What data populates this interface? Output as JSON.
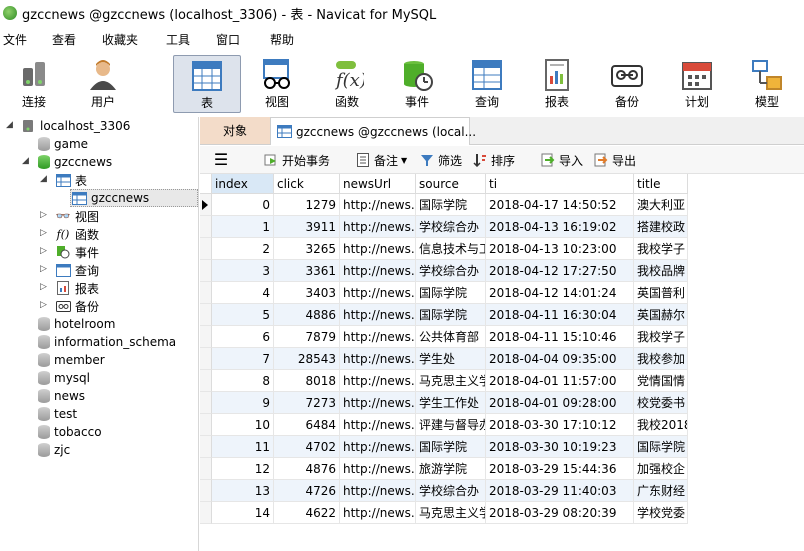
{
  "window": {
    "title": "gzccnews @gzccnews (localhost_3306) - 表 - Navicat for MySQL"
  },
  "menu": [
    "文件",
    "查看",
    "收藏夹",
    "工具",
    "窗口",
    "帮助"
  ],
  "toolbar": [
    {
      "label": "连接",
      "icon": "connection-icon"
    },
    {
      "label": "用户",
      "icon": "user-icon"
    },
    {
      "label": "表",
      "icon": "table-icon"
    },
    {
      "label": "视图",
      "icon": "view-icon"
    },
    {
      "label": "函数",
      "icon": "function-icon"
    },
    {
      "label": "事件",
      "icon": "event-icon"
    },
    {
      "label": "查询",
      "icon": "query-icon"
    },
    {
      "label": "报表",
      "icon": "report-icon"
    },
    {
      "label": "备份",
      "icon": "backup-icon"
    },
    {
      "label": "计划",
      "icon": "schedule-icon"
    },
    {
      "label": "模型",
      "icon": "model-icon"
    }
  ],
  "tree": {
    "connection": "localhost_3306",
    "databases": [
      "game",
      "gzccnews",
      "hotelroom",
      "information_schema",
      "member",
      "mysql",
      "news",
      "test",
      "tobacco",
      "zjc"
    ],
    "gzccnews_children": {
      "tables": "表",
      "table_item": "gzccnews",
      "others": [
        "视图",
        "函数",
        "事件",
        "查询",
        "报表",
        "备份"
      ]
    }
  },
  "tabs": {
    "objects": "对象",
    "table_tab": "gzccnews @gzccnews (local..."
  },
  "table_tools": {
    "begin_tx": "开始事务",
    "note": "备注",
    "filter": "筛选",
    "sort": "排序",
    "import": "导入",
    "export": "导出"
  },
  "grid": {
    "columns": [
      "index",
      "click",
      "newsUrl",
      "source",
      "ti",
      "title"
    ],
    "rows": [
      [
        "0",
        "1279",
        "http://news.g",
        "国际学院",
        "2018-04-17 14:50:52",
        "澳大利亚"
      ],
      [
        "1",
        "3911",
        "http://news.g",
        "学校综合办",
        "2018-04-13 16:19:02",
        "搭建校政"
      ],
      [
        "2",
        "3265",
        "http://news.g",
        "信息技术与工",
        "2018-04-13 10:23:00",
        "我校学子"
      ],
      [
        "3",
        "3361",
        "http://news.g",
        "学校综合办",
        "2018-04-12 17:27:50",
        "我校品牌"
      ],
      [
        "4",
        "3403",
        "http://news.g",
        "国际学院",
        "2018-04-12 14:01:24",
        "英国普利"
      ],
      [
        "5",
        "4886",
        "http://news.g",
        "国际学院",
        "2018-04-11 16:30:04",
        "英国赫尔"
      ],
      [
        "6",
        "7879",
        "http://news.g",
        "公共体育部",
        "2018-04-11 15:10:46",
        "我校学子"
      ],
      [
        "7",
        "28543",
        "http://news.g",
        "学生处",
        "2018-04-04 09:35:00",
        "我校参加"
      ],
      [
        "8",
        "8018",
        "http://news.g",
        "马克思主义学",
        "2018-04-01 11:57:00",
        "党情国情"
      ],
      [
        "9",
        "7273",
        "http://news.g",
        "学生工作处",
        "2018-04-01 09:28:00",
        "校党委书"
      ],
      [
        "10",
        "6484",
        "http://news.g",
        "评建与督导办",
        "2018-03-30 17:10:12",
        "我校2018"
      ],
      [
        "11",
        "4702",
        "http://news.g",
        "国际学院",
        "2018-03-30 10:19:23",
        "国际学院"
      ],
      [
        "12",
        "4876",
        "http://news.g",
        "旅游学院",
        "2018-03-29 15:44:36",
        "加强校企"
      ],
      [
        "13",
        "4726",
        "http://news.g",
        "学校综合办",
        "2018-03-29 11:40:03",
        "广东财经"
      ],
      [
        "14",
        "4622",
        "http://news.g",
        "马克思主义学",
        "2018-03-29 08:20:39",
        "学校党委"
      ]
    ]
  }
}
